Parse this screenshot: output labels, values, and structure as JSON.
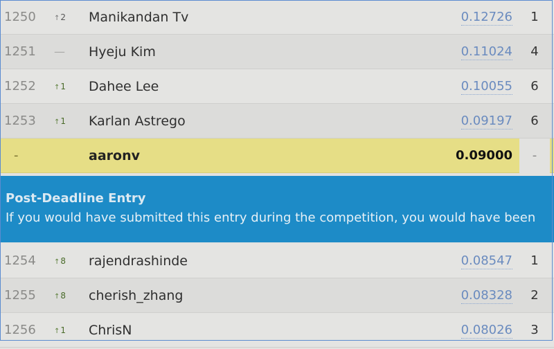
{
  "rows_top": [
    {
      "rank": "1250",
      "change": "2",
      "dir": "up-gray",
      "name": "Manikandan Tv",
      "score": "0.12726",
      "entries": "1"
    },
    {
      "rank": "1251",
      "change": "—",
      "dir": "none",
      "name": "Hyeju Kim",
      "score": "0.11024",
      "entries": "4"
    },
    {
      "rank": "1252",
      "change": "1",
      "dir": "up",
      "name": "Dahee Lee",
      "score": "0.10055",
      "entries": "6"
    },
    {
      "rank": "1253",
      "change": "1",
      "dir": "up",
      "name": "Karlan Astrego",
      "score": "0.09197",
      "entries": "6"
    }
  ],
  "highlight_row": {
    "rank": "-",
    "name": "aaronv",
    "score": "0.09000",
    "entries": "-"
  },
  "banner": {
    "title": "Post-Deadline Entry",
    "message": "If you would have submitted this entry during the competition, you would have been"
  },
  "rows_bottom": [
    {
      "rank": "1254",
      "change": "8",
      "dir": "up",
      "name": "rajendrashinde",
      "score": "0.08547",
      "entries": "1"
    },
    {
      "rank": "1255",
      "change": "8",
      "dir": "up",
      "name": "cherish_zhang",
      "score": "0.08328",
      "entries": "2"
    },
    {
      "rank": "1256",
      "change": "1",
      "dir": "up",
      "name": "ChrisN",
      "score": "0.08026",
      "entries": "3"
    }
  ],
  "colors": {
    "highlight": "#e6de86",
    "banner": "#1d8bc7",
    "link": "#6a8bbf"
  }
}
